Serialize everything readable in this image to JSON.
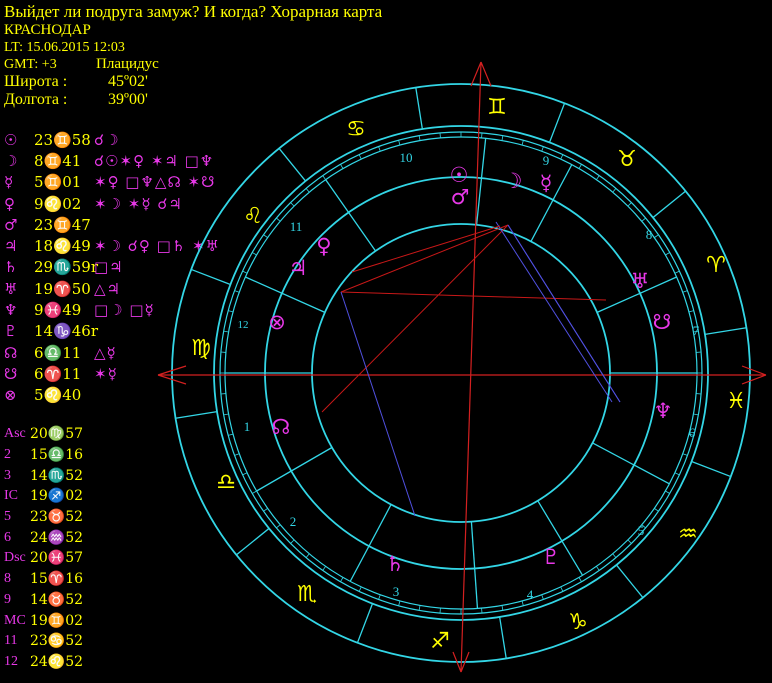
{
  "header": {
    "title": "Выйдет ли подруга замуж? И когда? Хорарная карта",
    "city": "КРАСНОДАР",
    "local_time": "LT: 15.06.2015  12:03",
    "gmt": "GMT: +3",
    "house_system": "Плацидус",
    "latitude_label": "Широта :",
    "latitude_value": "45º02'",
    "longitude_label": "Долгота :",
    "longitude_value": "39º00'"
  },
  "colors": {
    "text": "#ffff00",
    "glyph": "#e838e8",
    "ring": "#33d6e6",
    "axis": "#d42020",
    "aspect_red": "#c81818",
    "aspect_blue": "#5050e0"
  },
  "planets": [
    {
      "sym": "☉",
      "pos": "23♊58",
      "asp": "☌☽"
    },
    {
      "sym": "☽",
      "pos": "8♊41",
      "asp": "☌☉✶♀ ✶♃ □♆"
    },
    {
      "sym": "☿",
      "pos": "5♊01",
      "asp": "✶♀ □♆△☊ ✶☋"
    },
    {
      "sym": "♀",
      "pos": "9♌02",
      "asp": "✶☽ ✶☿ ☌♃"
    },
    {
      "sym": "♂",
      "pos": "23♊47",
      "asp": ""
    },
    {
      "sym": "♃",
      "pos": "18♌49",
      "asp": "✶☽ ☌♀ □♄ ✶♅"
    },
    {
      "sym": "♄",
      "pos": "29♏59r",
      "asp": "□♃"
    },
    {
      "sym": "♅",
      "pos": "19♈50",
      "asp": "△♃"
    },
    {
      "sym": "♆",
      "pos": "9♓49",
      "asp": "□☽ □☿"
    },
    {
      "sym": "♇",
      "pos": "14♑46r",
      "asp": ""
    },
    {
      "sym": "☊",
      "pos": "6♎11",
      "asp": "△☿"
    },
    {
      "sym": "☋",
      "pos": "6♈11",
      "asp": "✶☿"
    },
    {
      "sym": "⊗",
      "pos": "5♌40",
      "asp": ""
    }
  ],
  "cusps": [
    {
      "label": "Asc",
      "pos": "20♍57"
    },
    {
      "label": "2",
      "pos": "15♎16"
    },
    {
      "label": "3",
      "pos": "14♏52"
    },
    {
      "label": "IC",
      "pos": "19♐02"
    },
    {
      "label": "5",
      "pos": "23♉52"
    },
    {
      "label": "6",
      "pos": "24♒52"
    },
    {
      "label": "Dsc",
      "pos": "20♓57"
    },
    {
      "label": "8",
      "pos": "15♈16"
    },
    {
      "label": "9",
      "pos": "14♉52"
    },
    {
      "label": "MC",
      "pos": "19♊02"
    },
    {
      "label": "11",
      "pos": "23♋52"
    },
    {
      "label": "12",
      "pos": "24♌52"
    }
  ],
  "wheel": {
    "sign_glyphs": [
      "♊",
      "♉",
      "♈",
      "♓",
      "♒",
      "♑",
      "♐",
      "♏",
      "♎",
      "♍",
      "♌",
      "♋"
    ],
    "house_numbers": [
      "10",
      "9",
      "8",
      "7",
      "6",
      "5",
      "4",
      "3",
      "2",
      "1",
      "12",
      "11"
    ],
    "planet_glyphs": [
      "☉",
      "☽",
      "☿",
      "♂",
      "♀",
      "♃",
      "⊗",
      "♅",
      "☋",
      "♆",
      "♇",
      "♄",
      "☊"
    ]
  }
}
